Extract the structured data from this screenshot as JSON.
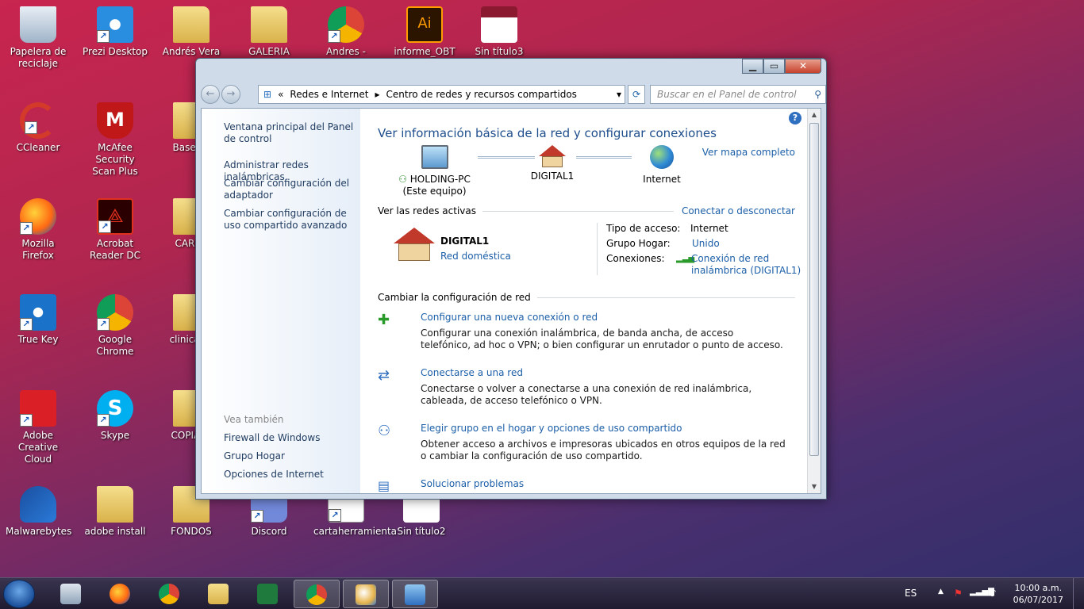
{
  "desktop": {
    "icons": [
      {
        "label": "Papelera de reciclaje",
        "icon": "recycle-bin-icon"
      },
      {
        "label": "Prezi Desktop",
        "icon": "prezi-icon"
      },
      {
        "label": "Andrés Vera",
        "icon": "folder-icon"
      },
      {
        "label": "GALERIA",
        "icon": "folder-icon"
      },
      {
        "label": "Andres - Chrome",
        "icon": "chrome-icon"
      },
      {
        "label": "informe_OBT",
        "icon": "illustrator-icon"
      },
      {
        "label": "Sin título3",
        "icon": "image-icon"
      },
      {
        "label": "CCleaner",
        "icon": "ccleaner-icon"
      },
      {
        "label": "McAfee Security Scan Plus",
        "icon": "mcafee-icon"
      },
      {
        "label": "Bases d",
        "icon": "folder-icon"
      },
      {
        "label": "Mozilla Firefox",
        "icon": "firefox-icon"
      },
      {
        "label": "Acrobat Reader DC",
        "icon": "acrobat-icon"
      },
      {
        "label": "CAROL",
        "icon": "folder-icon"
      },
      {
        "label": "True Key",
        "icon": "truekey-icon"
      },
      {
        "label": "Google Chrome",
        "icon": "chrome-icon"
      },
      {
        "label": "clinicas c",
        "icon": "folder-icon"
      },
      {
        "label": "Adobe Creative Cloud",
        "icon": "creative-cloud-icon"
      },
      {
        "label": "Skype",
        "icon": "skype-icon"
      },
      {
        "label": "COPIA M",
        "icon": "folder-icon"
      },
      {
        "label": "Malwarebytes",
        "icon": "malwarebytes-icon"
      },
      {
        "label": "adobe install",
        "icon": "folder-icon"
      },
      {
        "label": "FONDOS",
        "icon": "folder-icon"
      },
      {
        "label": "Discord",
        "icon": "discord-icon"
      },
      {
        "label": "cartaherramienta",
        "icon": "document-icon"
      },
      {
        "label": "Sin título2",
        "icon": "image-icon"
      }
    ]
  },
  "window": {
    "breadcrumb_prefix": "«",
    "breadcrumb": [
      "Redes e Internet",
      "Centro de redes y recursos compartidos"
    ],
    "search_placeholder": "Buscar en el Panel de control",
    "left_links": [
      "Ventana principal del Panel de control",
      "Administrar redes inalámbricas",
      "Cambiar configuración del adaptador",
      "Cambiar configuración de uso compartido avanzado"
    ],
    "see_also_label": "Vea también",
    "see_also": [
      "Firewall de Windows",
      "Grupo Hogar",
      "Opciones de Internet"
    ],
    "heading": "Ver información básica de la red y configurar conexiones",
    "full_map_link": "Ver mapa completo",
    "map": {
      "computer": "HOLDING-PC",
      "computer_sub": "(Este equipo)",
      "network": "DIGITAL1",
      "internet": "Internet"
    },
    "active_networks_label": "Ver las redes activas",
    "connect_link": "Conectar o desconectar",
    "active_network": {
      "name": "DIGITAL1",
      "type": "Red doméstica",
      "access_type_label": "Tipo de acceso:",
      "access_type": "Internet",
      "homegroup_label": "Grupo Hogar:",
      "homegroup": "Unido",
      "connections_label": "Conexiones:",
      "connection": "Conexión de red inalámbrica (DIGITAL1)"
    },
    "change_settings_label": "Cambiar la configuración de red",
    "tasks": [
      {
        "title": "Configurar una nueva conexión o red",
        "desc": "Configurar una conexión inalámbrica, de banda ancha, de acceso telefónico, ad hoc o VPN; o bien configurar un enrutador o punto de acceso."
      },
      {
        "title": "Conectarse a una red",
        "desc": "Conectarse o volver a conectarse a una conexión de red inalámbrica, cableada, de acceso telefónico o VPN."
      },
      {
        "title": "Elegir grupo en el hogar y opciones de uso compartido",
        "desc": "Obtener acceso a archivos e impresoras ubicados en otros equipos de la red o cambiar la configuración de uso compartido."
      },
      {
        "title": "Solucionar problemas",
        "desc": ""
      }
    ]
  },
  "taskbar": {
    "language": "ES",
    "time": "10:00 a.m.",
    "date": "06/07/2017"
  }
}
